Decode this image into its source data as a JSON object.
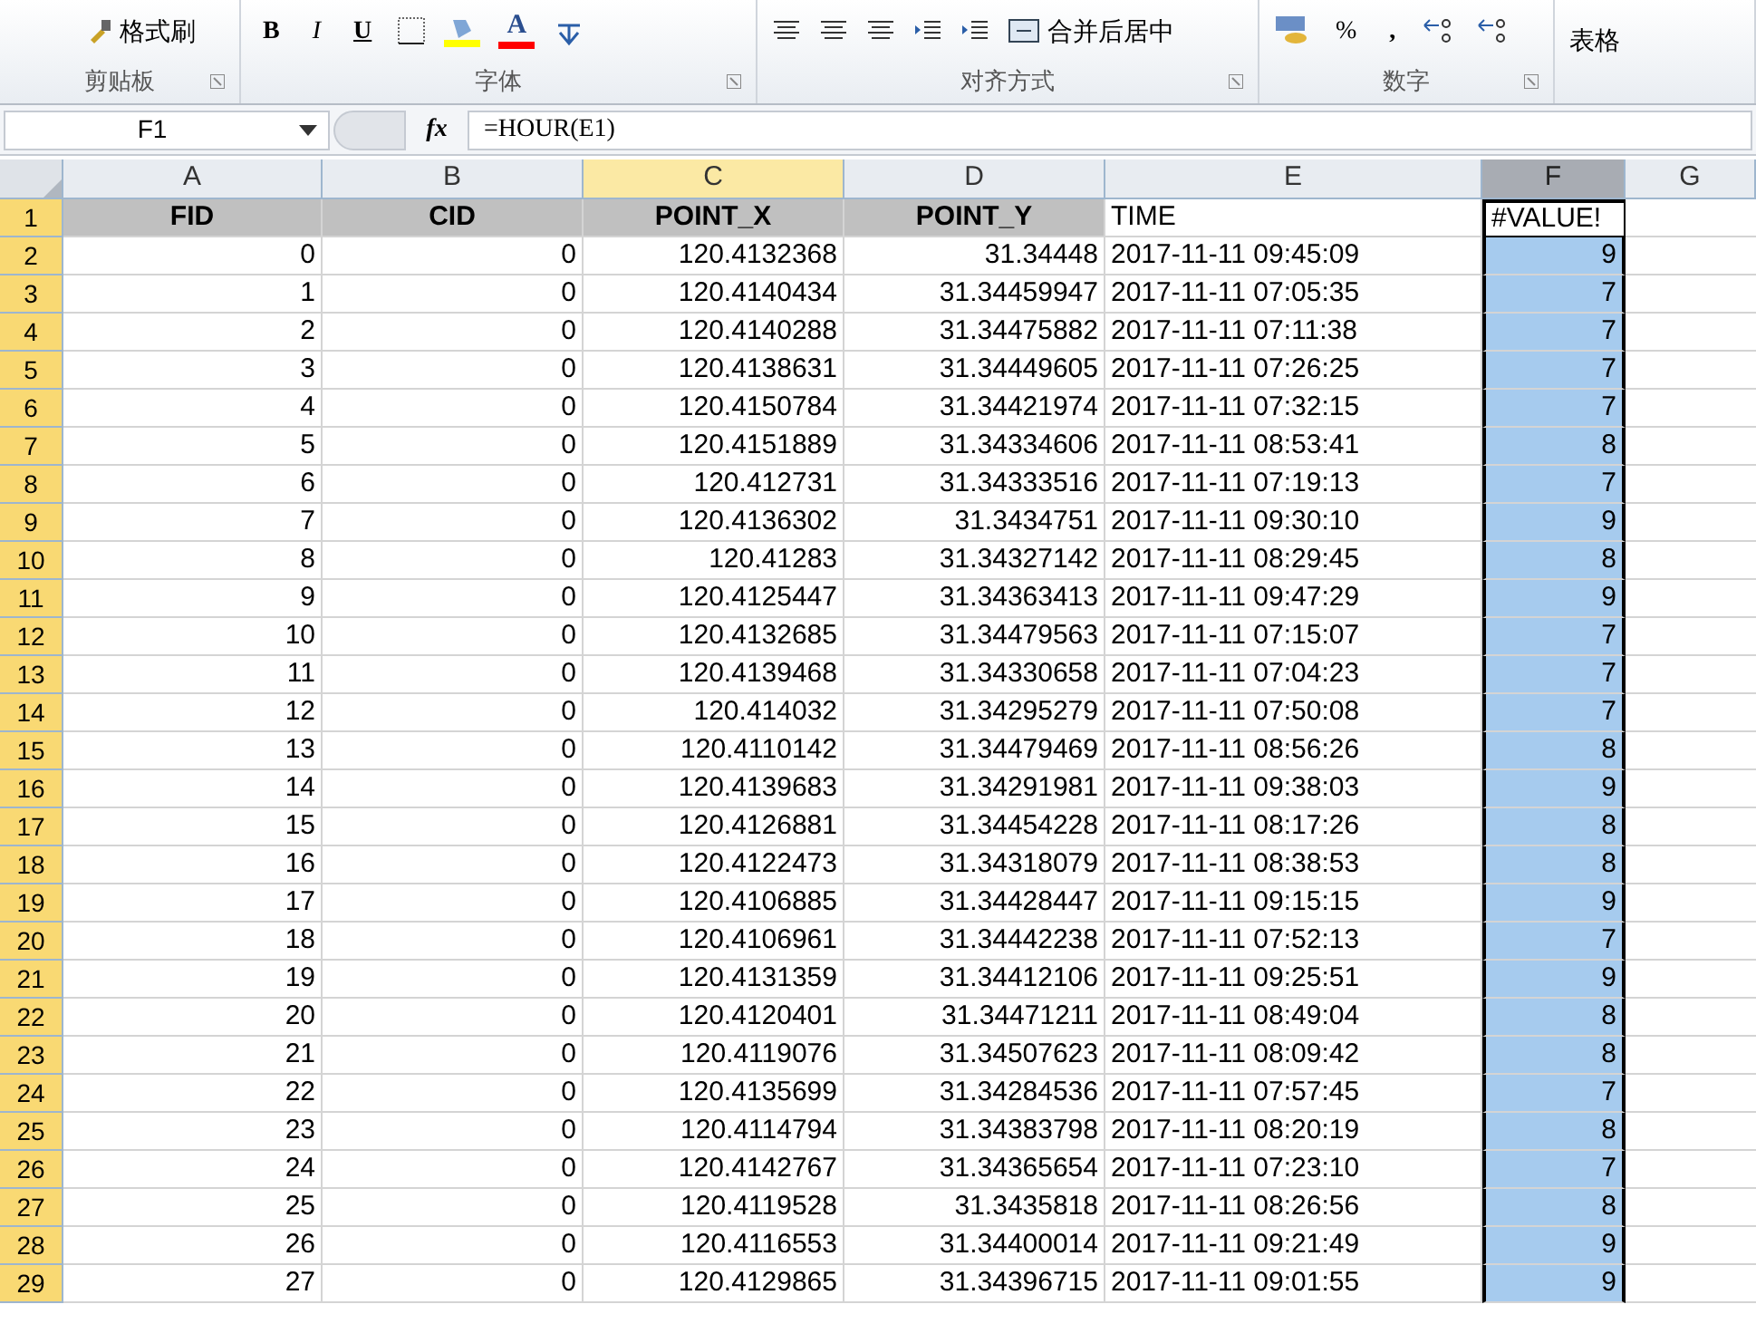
{
  "ribbon": {
    "groups": [
      {
        "label": "剪贴板",
        "buttons": [
          {
            "kind": "painter",
            "label": "格式刷"
          }
        ]
      },
      {
        "label": "字体",
        "buttons": [
          {
            "kind": "bold",
            "label": "B"
          },
          {
            "kind": "italic",
            "label": "I"
          },
          {
            "kind": "underline",
            "label": "U"
          },
          {
            "kind": "border"
          },
          {
            "kind": "fill",
            "color": "#ffff00"
          },
          {
            "kind": "fontcolor",
            "label": "A",
            "color": "#ff0000"
          },
          {
            "kind": "phonetic"
          }
        ]
      },
      {
        "label": "对齐方式",
        "buttons": [
          {
            "kind": "align"
          },
          {
            "kind": "align"
          },
          {
            "kind": "align"
          },
          {
            "kind": "indent"
          },
          {
            "kind": "indent"
          },
          {
            "kind": "merge",
            "label": "合并后居中"
          }
        ]
      },
      {
        "label": "数字",
        "buttons": [
          {
            "kind": "accounting"
          },
          {
            "kind": "percent",
            "label": "%"
          },
          {
            "kind": "comma",
            "label": ","
          },
          {
            "kind": "decimal"
          },
          {
            "kind": "decimal"
          }
        ]
      },
      {
        "buttons": [
          {
            "kind": "partial",
            "label": "表格"
          }
        ]
      }
    ]
  },
  "formula_bar": {
    "name_box": "F1",
    "function_label": "fx",
    "formula": "=HOUR(E1)"
  },
  "sheet": {
    "columns": [
      {
        "label": "A",
        "selected": false,
        "highlighted": false
      },
      {
        "label": "B",
        "selected": false,
        "highlighted": false
      },
      {
        "label": "C",
        "selected": false,
        "highlighted": true
      },
      {
        "label": "D",
        "selected": false,
        "highlighted": false
      },
      {
        "label": "E",
        "selected": false,
        "highlighted": false
      },
      {
        "label": "F",
        "selected": true,
        "highlighted": false
      },
      {
        "label": "G",
        "selected": false,
        "highlighted": false
      }
    ],
    "rows": [
      {
        "number": "1",
        "header": true,
        "cells": [
          "FID",
          "CID",
          "POINT_X",
          "POINT_Y",
          "TIME",
          "#VALUE!"
        ]
      },
      {
        "number": "2",
        "cells": [
          "0",
          "0",
          "120.4132368",
          "31.34448",
          "2017-11-11 09:45:09",
          "9"
        ]
      },
      {
        "number": "3",
        "cells": [
          "1",
          "0",
          "120.4140434",
          "31.34459947",
          "2017-11-11 07:05:35",
          "7"
        ]
      },
      {
        "number": "4",
        "cells": [
          "2",
          "0",
          "120.4140288",
          "31.34475882",
          "2017-11-11 07:11:38",
          "7"
        ]
      },
      {
        "number": "5",
        "cells": [
          "3",
          "0",
          "120.4138631",
          "31.34449605",
          "2017-11-11 07:26:25",
          "7"
        ]
      },
      {
        "number": "6",
        "cells": [
          "4",
          "0",
          "120.4150784",
          "31.34421974",
          "2017-11-11 07:32:15",
          "7"
        ]
      },
      {
        "number": "7",
        "cells": [
          "5",
          "0",
          "120.4151889",
          "31.34334606",
          "2017-11-11 08:53:41",
          "8"
        ]
      },
      {
        "number": "8",
        "cells": [
          "6",
          "0",
          "120.412731",
          "31.34333516",
          "2017-11-11 07:19:13",
          "7"
        ]
      },
      {
        "number": "9",
        "cells": [
          "7",
          "0",
          "120.4136302",
          "31.3434751",
          "2017-11-11 09:30:10",
          "9"
        ]
      },
      {
        "number": "10",
        "cells": [
          "8",
          "0",
          "120.41283",
          "31.34327142",
          "2017-11-11 08:29:45",
          "8"
        ]
      },
      {
        "number": "11",
        "cells": [
          "9",
          "0",
          "120.4125447",
          "31.34363413",
          "2017-11-11 09:47:29",
          "9"
        ]
      },
      {
        "number": "12",
        "cells": [
          "10",
          "0",
          "120.4132685",
          "31.34479563",
          "2017-11-11 07:15:07",
          "7"
        ]
      },
      {
        "number": "13",
        "cells": [
          "11",
          "0",
          "120.4139468",
          "31.34330658",
          "2017-11-11 07:04:23",
          "7"
        ]
      },
      {
        "number": "14",
        "cells": [
          "12",
          "0",
          "120.414032",
          "31.34295279",
          "2017-11-11 07:50:08",
          "7"
        ]
      },
      {
        "number": "15",
        "cells": [
          "13",
          "0",
          "120.4110142",
          "31.34479469",
          "2017-11-11 08:56:26",
          "8"
        ]
      },
      {
        "number": "16",
        "cells": [
          "14",
          "0",
          "120.4139683",
          "31.34291981",
          "2017-11-11 09:38:03",
          "9"
        ]
      },
      {
        "number": "17",
        "cells": [
          "15",
          "0",
          "120.4126881",
          "31.34454228",
          "2017-11-11 08:17:26",
          "8"
        ]
      },
      {
        "number": "18",
        "cells": [
          "16",
          "0",
          "120.4122473",
          "31.34318079",
          "2017-11-11 08:38:53",
          "8"
        ]
      },
      {
        "number": "19",
        "cells": [
          "17",
          "0",
          "120.4106885",
          "31.34428447",
          "2017-11-11 09:15:15",
          "9"
        ]
      },
      {
        "number": "20",
        "cells": [
          "18",
          "0",
          "120.4106961",
          "31.34442238",
          "2017-11-11 07:52:13",
          "7"
        ]
      },
      {
        "number": "21",
        "cells": [
          "19",
          "0",
          "120.4131359",
          "31.34412106",
          "2017-11-11 09:25:51",
          "9"
        ]
      },
      {
        "number": "22",
        "cells": [
          "20",
          "0",
          "120.4120401",
          "31.34471211",
          "2017-11-11 08:49:04",
          "8"
        ]
      },
      {
        "number": "23",
        "cells": [
          "21",
          "0",
          "120.4119076",
          "31.34507623",
          "2017-11-11 08:09:42",
          "8"
        ]
      },
      {
        "number": "24",
        "cells": [
          "22",
          "0",
          "120.4135699",
          "31.34284536",
          "2017-11-11 07:57:45",
          "7"
        ]
      },
      {
        "number": "25",
        "cells": [
          "23",
          "0",
          "120.4114794",
          "31.34383798",
          "2017-11-11 08:20:19",
          "8"
        ]
      },
      {
        "number": "26",
        "cells": [
          "24",
          "0",
          "120.4142767",
          "31.34365654",
          "2017-11-11 07:23:10",
          "7"
        ]
      },
      {
        "number": "27",
        "cells": [
          "25",
          "0",
          "120.4119528",
          "31.3435818",
          "2017-11-11 08:26:56",
          "8"
        ]
      },
      {
        "number": "28",
        "cells": [
          "26",
          "0",
          "120.4116553",
          "31.34400014",
          "2017-11-11 09:21:49",
          "9"
        ]
      },
      {
        "number": "29",
        "cells": [
          "27",
          "0",
          "120.4129865",
          "31.34396715",
          "2017-11-11 09:01:55",
          "9"
        ]
      }
    ]
  }
}
